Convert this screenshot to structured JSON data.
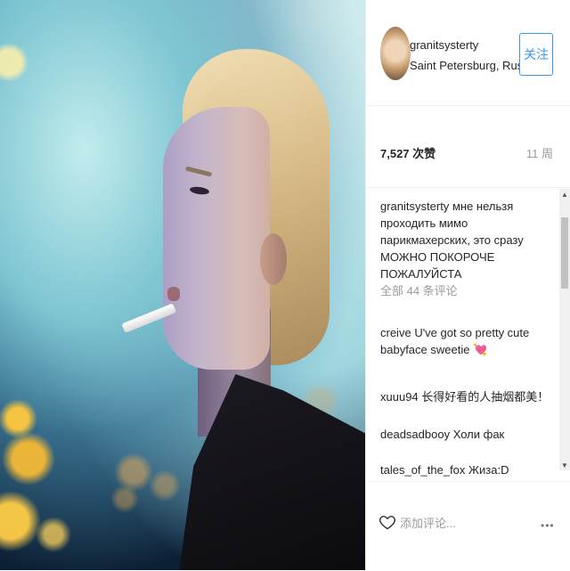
{
  "post": {
    "username": "granitsysterty",
    "location": "Saint Petersburg, Rus...",
    "follow_label": "关注",
    "likes": "7,527 次赞",
    "time_ago": "11 周",
    "caption": {
      "user": "granitsysterty",
      "text": "мне нельзя проходить мимо парикмахерских, это сразу МОЖНО ПОКОРОЧЕ ПОЖАЛУЙСТА"
    },
    "view_all": "全部 44 条评论",
    "comments": [
      {
        "user": "creive",
        "text": "U've got so pretty cute babyface sweetie 💘"
      },
      {
        "user": "xuuu94",
        "text": "长得好看的人抽烟都美！"
      },
      {
        "user": "deadsadbooy",
        "text": "Холи фак"
      },
      {
        "user": "tales_of_the_fox",
        "text": "Жиза:D"
      }
    ],
    "add_comment_placeholder": "添加评论...",
    "more_label": "•••"
  },
  "colors": {
    "accent": "#3897f0",
    "muted": "#999999",
    "text": "#262626"
  }
}
